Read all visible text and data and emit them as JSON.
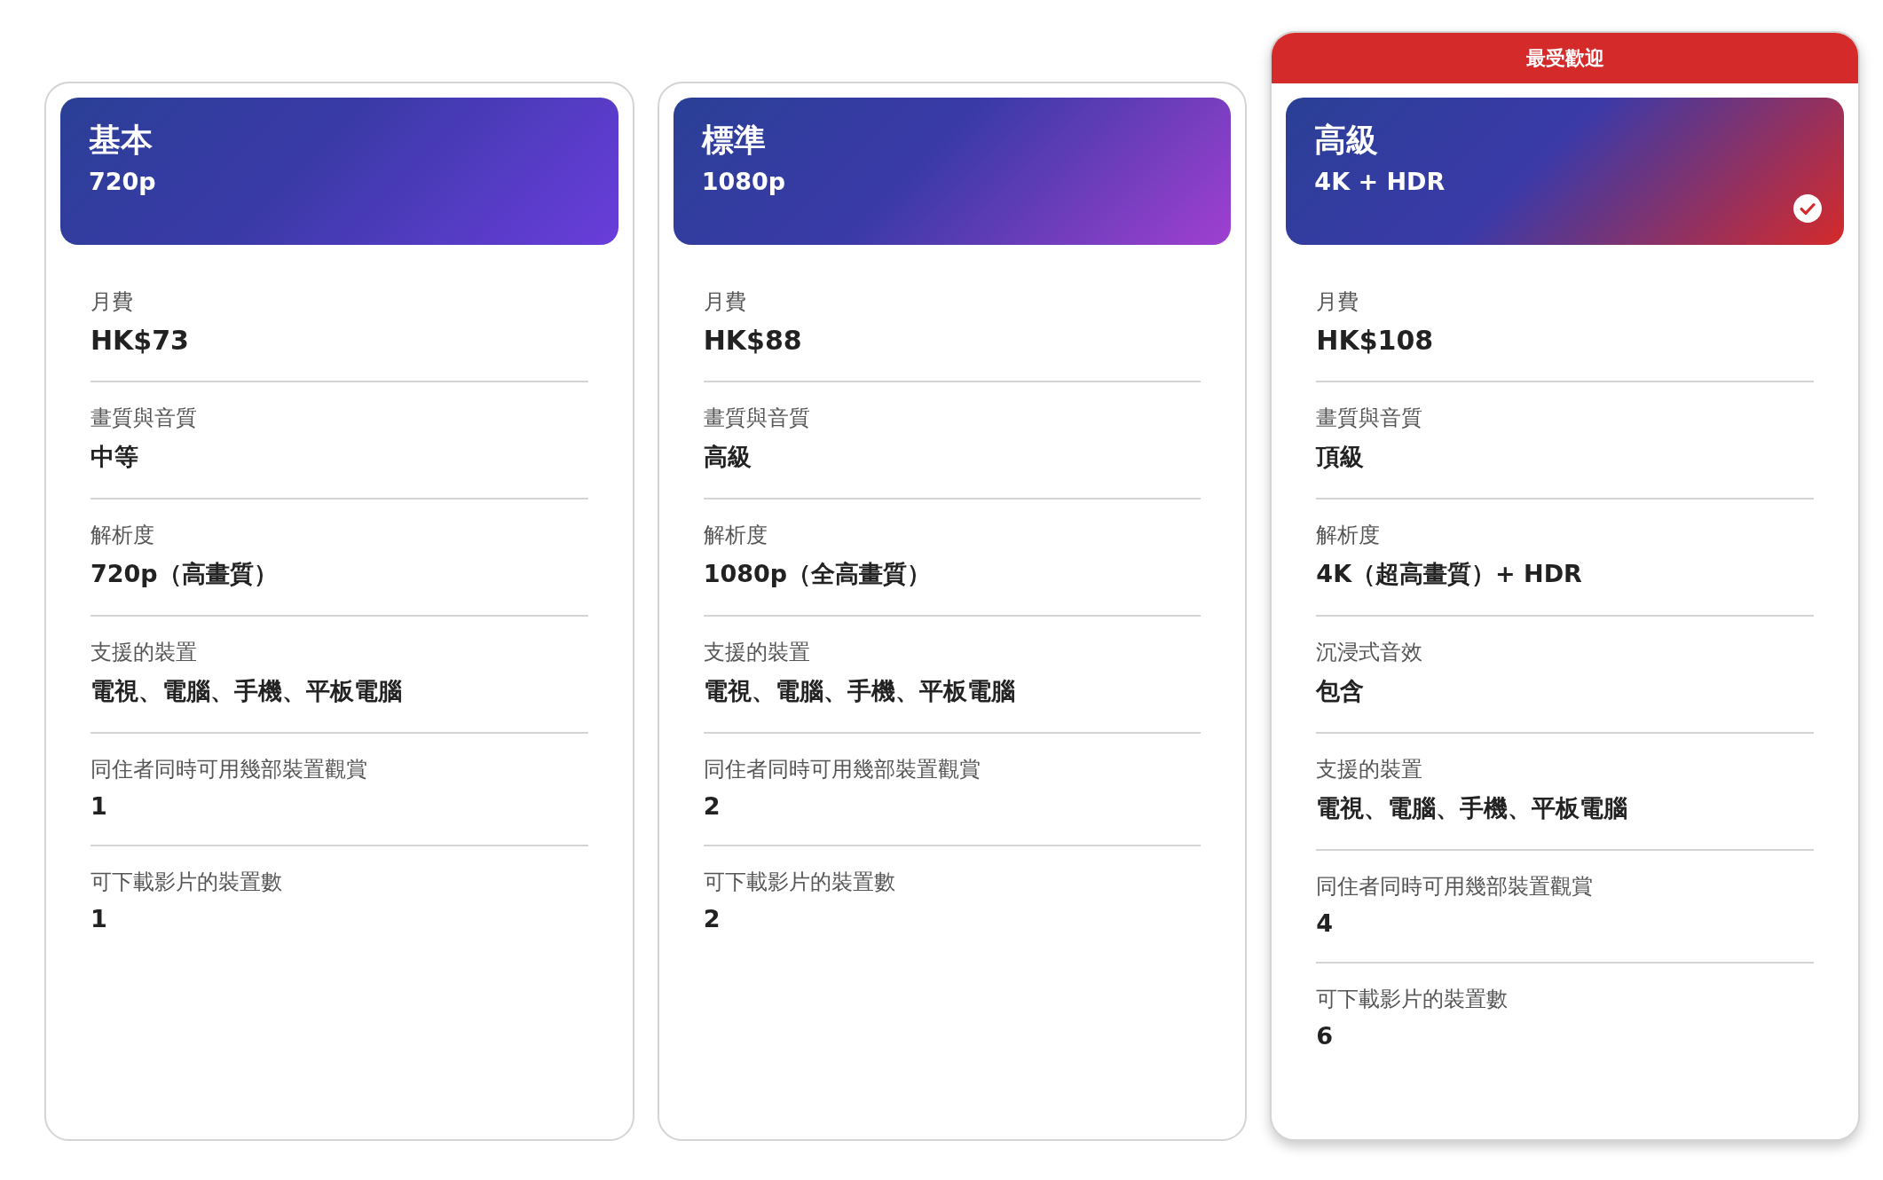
{
  "plans": [
    {
      "name": "基本",
      "resolution": "720p",
      "selected": false,
      "color": "#6a3ddb",
      "rows": [
        {
          "label": "月費",
          "value": "HK$73",
          "kind": "price"
        },
        {
          "label": "畫質與音質",
          "value": "中等",
          "kind": "text"
        },
        {
          "label": "解析度",
          "value": "720p（高畫質）",
          "kind": "text"
        },
        {
          "label": "支援的裝置",
          "value": "電視、電腦、手機、平板電腦",
          "kind": "text"
        },
        {
          "label": "同住者同時可用幾部裝置觀賞",
          "value": "1",
          "kind": "text"
        },
        {
          "label": "可下載影片的裝置數",
          "value": "1",
          "kind": "text"
        }
      ]
    },
    {
      "name": "標準",
      "resolution": "1080p",
      "selected": false,
      "color": "#a040d0",
      "rows": [
        {
          "label": "月費",
          "value": "HK$88",
          "kind": "price"
        },
        {
          "label": "畫質與音質",
          "value": "高級",
          "kind": "text"
        },
        {
          "label": "解析度",
          "value": "1080p（全高畫質）",
          "kind": "text"
        },
        {
          "label": "支援的裝置",
          "value": "電視、電腦、手機、平板電腦",
          "kind": "text"
        },
        {
          "label": "同住者同時可用幾部裝置觀賞",
          "value": "2",
          "kind": "text"
        },
        {
          "label": "可下載影片的裝置數",
          "value": "2",
          "kind": "text"
        }
      ]
    },
    {
      "name": "高級",
      "resolution": "4K + HDR",
      "selected": true,
      "color": "#d52a2a",
      "badge": "最受歡迎",
      "rows": [
        {
          "label": "月費",
          "value": "HK$108",
          "kind": "price"
        },
        {
          "label": "畫質與音質",
          "value": "頂級",
          "kind": "text"
        },
        {
          "label": "解析度",
          "value": "4K（超高畫質）+ HDR",
          "kind": "text"
        },
        {
          "label": "沉浸式音效",
          "value": "包含",
          "kind": "text"
        },
        {
          "label": "支援的裝置",
          "value": "電視、電腦、手機、平板電腦",
          "kind": "text"
        },
        {
          "label": "同住者同時可用幾部裝置觀賞",
          "value": "4",
          "kind": "text"
        },
        {
          "label": "可下載影片的裝置數",
          "value": "6",
          "kind": "text"
        }
      ]
    }
  ]
}
